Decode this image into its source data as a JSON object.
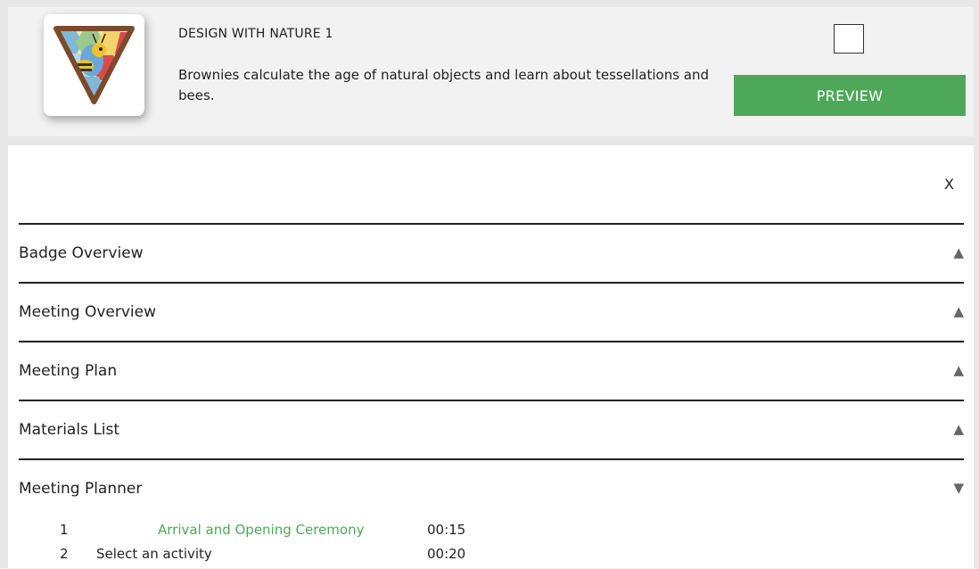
{
  "badge": {
    "title": "DESIGN WITH NATURE 1",
    "description": "Brownies calculate the age of natural objects and learn about tessellations and bees.",
    "preview_label": "PREVIEW"
  },
  "panel": {
    "close_label": "X",
    "sections": [
      {
        "label": "Badge Overview",
        "arrow": "▲"
      },
      {
        "label": "Meeting Overview",
        "arrow": "▲"
      },
      {
        "label": "Meeting Plan",
        "arrow": "▲"
      },
      {
        "label": "Materials List",
        "arrow": "▲"
      },
      {
        "label": "Meeting Planner",
        "arrow": "▼"
      }
    ],
    "planner": [
      {
        "num": "1",
        "name": "Arrival and Opening Ceremony",
        "time": "00:15"
      },
      {
        "num": "2",
        "name": "Select an activity",
        "time": "00:20"
      }
    ]
  },
  "colors": {
    "accent_green": "#4ea85a",
    "badge_border": "#7a4a2a"
  },
  "icons": {
    "badge": "bee-badge-icon",
    "collapsed": "triangle-up-icon",
    "expanded": "triangle-down-icon"
  }
}
